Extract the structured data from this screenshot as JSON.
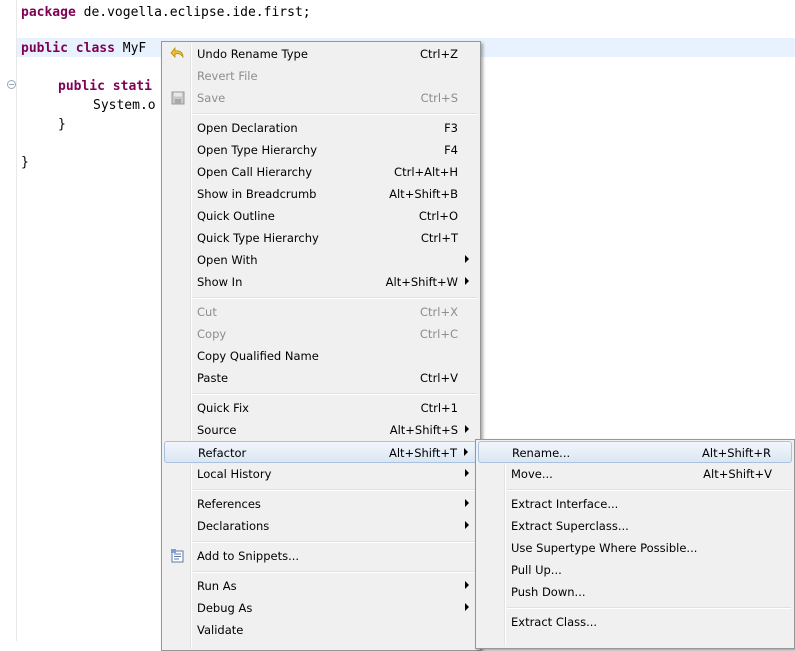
{
  "editor": {
    "lines": {
      "l1_kw": "package",
      "l1_rest": " de.vogella.eclipse.ide.first;",
      "l2_kw": "public class",
      "l2_rest": " MyF",
      "l3_kw": "public stati",
      "l3_rest": "",
      "l4": "System.o",
      "l5": "}",
      "l6": "}"
    }
  },
  "context_menu": {
    "items": [
      {
        "label": "Undo Rename Type",
        "shortcut": "Ctrl+Z",
        "icon": "undo-icon"
      },
      {
        "label": "Revert File",
        "shortcut": ""
      },
      {
        "label": "Save",
        "shortcut": "Ctrl+S",
        "icon": "save-icon"
      },
      {
        "label": "Open Declaration",
        "shortcut": "F3"
      },
      {
        "label": "Open Type Hierarchy",
        "shortcut": "F4"
      },
      {
        "label": "Open Call Hierarchy",
        "shortcut": "Ctrl+Alt+H"
      },
      {
        "label": "Show in Breadcrumb",
        "shortcut": "Alt+Shift+B"
      },
      {
        "label": "Quick Outline",
        "shortcut": "Ctrl+O"
      },
      {
        "label": "Quick Type Hierarchy",
        "shortcut": "Ctrl+T"
      },
      {
        "label": "Open With",
        "shortcut": ""
      },
      {
        "label": "Show In",
        "shortcut": "Alt+Shift+W"
      },
      {
        "label": "Cut",
        "shortcut": "Ctrl+X"
      },
      {
        "label": "Copy",
        "shortcut": "Ctrl+C"
      },
      {
        "label": "Copy Qualified Name",
        "shortcut": ""
      },
      {
        "label": "Paste",
        "shortcut": "Ctrl+V"
      },
      {
        "label": "Quick Fix",
        "shortcut": "Ctrl+1"
      },
      {
        "label": "Source",
        "shortcut": "Alt+Shift+S"
      },
      {
        "label": "Refactor",
        "shortcut": "Alt+Shift+T"
      },
      {
        "label": "Local History",
        "shortcut": ""
      },
      {
        "label": "References",
        "shortcut": ""
      },
      {
        "label": "Declarations",
        "shortcut": ""
      },
      {
        "label": "Add to Snippets...",
        "shortcut": "",
        "icon": "snippets-icon"
      },
      {
        "label": "Run As",
        "shortcut": ""
      },
      {
        "label": "Debug As",
        "shortcut": ""
      },
      {
        "label": "Validate",
        "shortcut": ""
      }
    ]
  },
  "refactor_submenu": {
    "items": [
      {
        "label": "Rename...",
        "shortcut": "Alt+Shift+R"
      },
      {
        "label": "Move...",
        "shortcut": "Alt+Shift+V"
      },
      {
        "label": "Extract Interface...",
        "shortcut": ""
      },
      {
        "label": "Extract Superclass...",
        "shortcut": ""
      },
      {
        "label": "Use Supertype Where Possible...",
        "shortcut": ""
      },
      {
        "label": "Pull Up...",
        "shortcut": ""
      },
      {
        "label": "Push Down...",
        "shortcut": ""
      },
      {
        "label": "Extract Class...",
        "shortcut": ""
      }
    ]
  },
  "colors": {
    "keyword": "#7f0055",
    "menu_bg": "#f0f0f0",
    "highlight_border": "#a8c2e0",
    "disabled_text": "#8d8d8d"
  }
}
